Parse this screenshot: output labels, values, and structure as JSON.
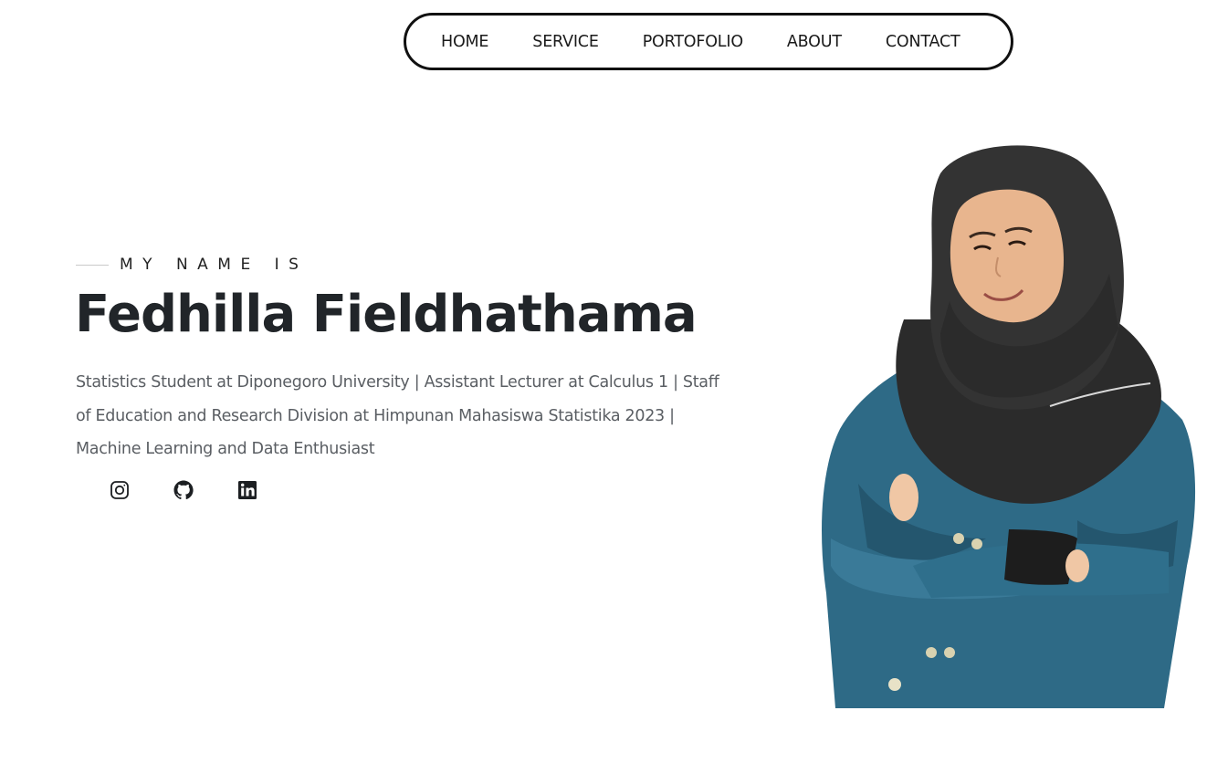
{
  "nav": {
    "items": [
      {
        "label": "HOME"
      },
      {
        "label": "SERVICE"
      },
      {
        "label": "PORTOFOLIO"
      },
      {
        "label": "ABOUT"
      },
      {
        "label": "CONTACT"
      }
    ]
  },
  "hero": {
    "eyebrow": "MY NAME IS",
    "name": "Fedhilla Fieldhathama",
    "bio": "Statistics Student at Diponegoro University | Assistant Lecturer at Calculus 1 | Staff of Education and Research Division at Himpunan Mahasiswa Statistika 2023 | Machine Learning and Data Enthusiast",
    "socials": [
      {
        "icon": "instagram-icon"
      },
      {
        "icon": "github-icon"
      },
      {
        "icon": "linkedin-icon"
      }
    ]
  },
  "portrait": {
    "description_icon": "profile-photo"
  },
  "colors": {
    "heading": "#212529",
    "body": "#5a5e63",
    "hijab": "#2b2b2b",
    "jacket": "#2e6a86",
    "skin": "#e8b58e"
  }
}
